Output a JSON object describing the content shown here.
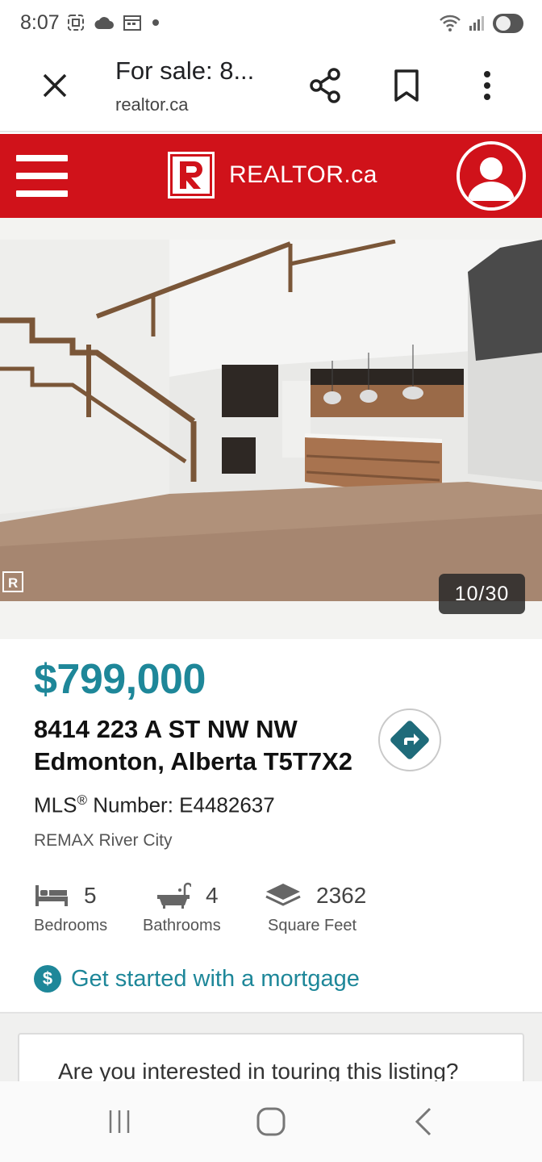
{
  "status_bar": {
    "time": "8:07",
    "left_icons": [
      "screenshot-icon",
      "cloud-icon",
      "calendar-icon",
      "dot-icon"
    ],
    "right_icons": [
      "wifi-icon",
      "signal-icon",
      "toggle-icon"
    ]
  },
  "browser": {
    "page_title": "For sale: 8...",
    "url": "realtor.ca"
  },
  "site_header": {
    "logo_text": "REALTOR.ca",
    "brand_color": "#d0121a"
  },
  "photo": {
    "counter": "10/30",
    "current": 10,
    "total": 30
  },
  "listing": {
    "price": "$799,000",
    "address_line1": "8414 223 A ST NW NW",
    "address_line2": "Edmonton, Alberta T5T7X2",
    "mls_prefix": "MLS",
    "mls_suffix": " Number: E4482637",
    "brokerage": "REMAX River City",
    "features": [
      {
        "icon": "bed-icon",
        "value": "5",
        "label": "Bedrooms"
      },
      {
        "icon": "bathtub-icon",
        "value": "4",
        "label": "Bathrooms"
      },
      {
        "icon": "square-feet-icon",
        "value": "2362",
        "label": "Square Feet"
      }
    ],
    "mortgage_link": "Get started with a mortgage",
    "accent_color": "#1e8799"
  },
  "tour": {
    "question": "Are you interested in touring this listing?"
  },
  "nav": {
    "buttons": [
      "recent-apps-button",
      "home-button",
      "back-button"
    ]
  }
}
